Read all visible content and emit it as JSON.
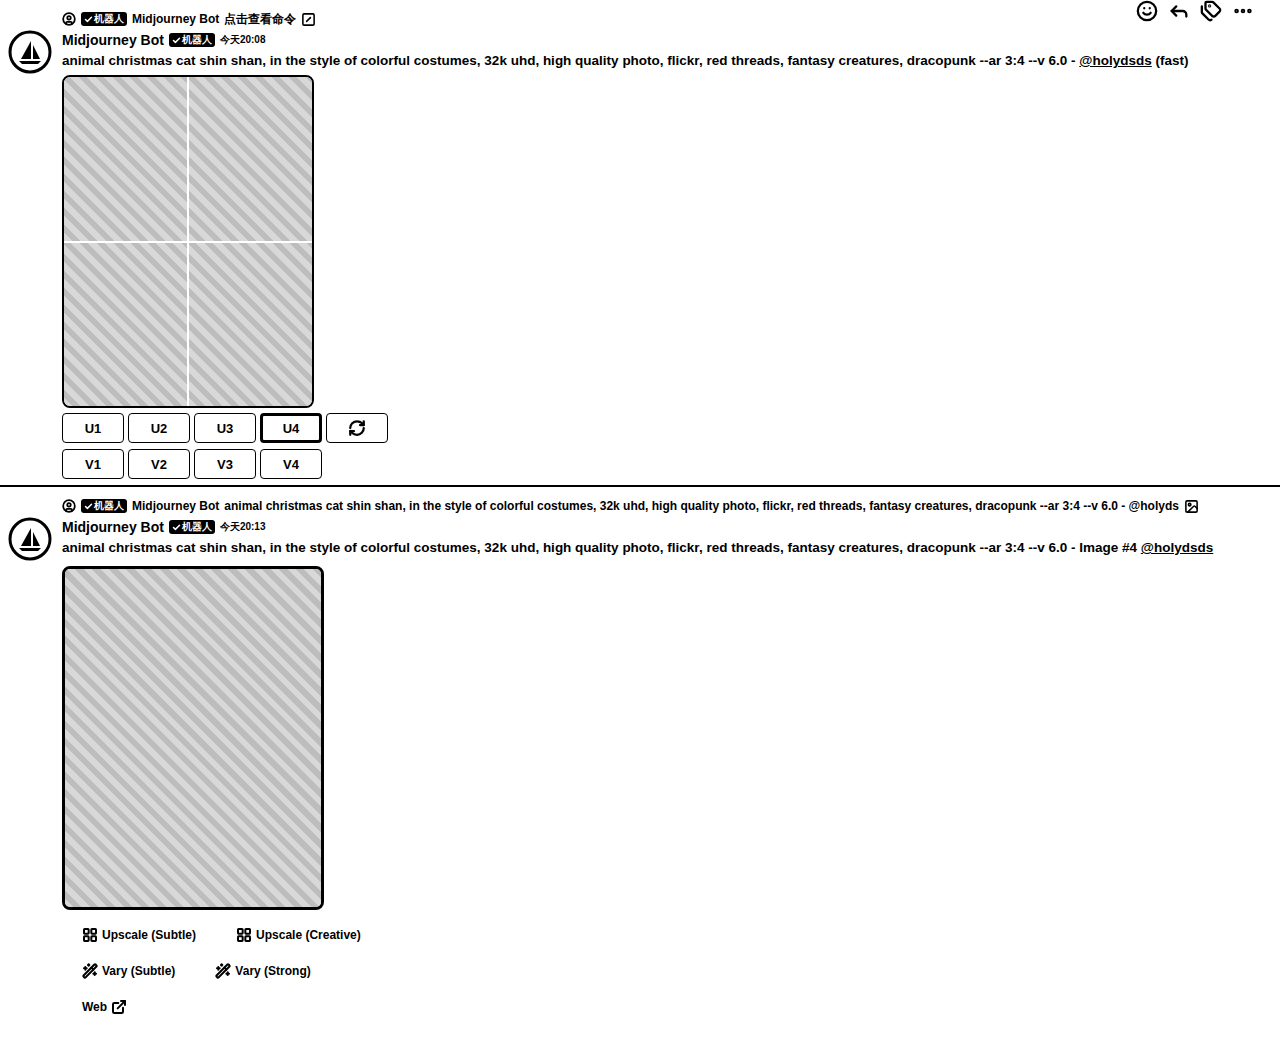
{
  "messages": [
    {
      "reply": {
        "badge": "机器人",
        "author": "Midjourney Bot",
        "text": "点击查看命令",
        "trailing": "command"
      },
      "author": "Midjourney Bot",
      "badge": "机器人",
      "time": "今天20:08",
      "content": [
        {
          "text": "animal christmas cat shin shan, in the style of colorful costumes, 32k uhd, high quality photo, flickr, red threads, fantasy creatures, dracopunk --ar 3:4 --v 6.0",
          "kind": "bold"
        },
        {
          "text": " - ",
          "kind": "plain"
        },
        {
          "text": "@holydsds",
          "kind": "mention"
        },
        {
          "text": " (fast)",
          "kind": "plain"
        }
      ],
      "image": {
        "kind": "grid",
        "tiles": 4
      },
      "button_rows": [
        [
          {
            "label": "U1",
            "kind": "text",
            "selected": false
          },
          {
            "label": "U2",
            "kind": "text",
            "selected": false
          },
          {
            "label": "U3",
            "kind": "text",
            "selected": false
          },
          {
            "label": "U4",
            "kind": "text",
            "selected": true
          },
          {
            "label": "",
            "kind": "refresh",
            "selected": false
          }
        ],
        [
          {
            "label": "V1",
            "kind": "text",
            "selected": false
          },
          {
            "label": "V2",
            "kind": "text",
            "selected": false
          },
          {
            "label": "V3",
            "kind": "text",
            "selected": false
          },
          {
            "label": "V4",
            "kind": "text",
            "selected": false
          }
        ]
      ]
    },
    {
      "reply": {
        "badge": "机器人",
        "author": "Midjourney Bot",
        "text": "animal christmas cat shin shan, in the style of colorful costumes, 32k uhd, high quality photo, flickr, red threads, fantasy creatures, dracopunk --ar 3:4 --v 6.0 - @holyds",
        "trailing": "image"
      },
      "author": "Midjourney Bot",
      "badge": "机器人",
      "time": "今天20:13",
      "content": [
        {
          "text": "animal christmas cat shin shan, in the style of colorful costumes, 32k uhd, high quality photo, flickr, red threads, fantasy creatures, dracopunk --ar 3:4 --v 6.0",
          "kind": "bold"
        },
        {
          "text": " - Image #4 ",
          "kind": "plain"
        },
        {
          "text": "@holydsds",
          "kind": "mention"
        }
      ],
      "image": {
        "kind": "single",
        "tiles": 1
      },
      "button_rows": [
        [
          {
            "label": "Upscale (Subtle)",
            "kind": "upscale",
            "selected": false
          },
          {
            "label": "Upscale (Creative)",
            "kind": "upscale",
            "selected": false
          }
        ],
        [
          {
            "label": "Vary (Subtle)",
            "kind": "vary",
            "selected": false
          },
          {
            "label": "Vary (Strong)",
            "kind": "vary",
            "selected": false
          }
        ],
        [
          {
            "label": "Web",
            "kind": "link",
            "selected": false
          }
        ]
      ]
    }
  ]
}
